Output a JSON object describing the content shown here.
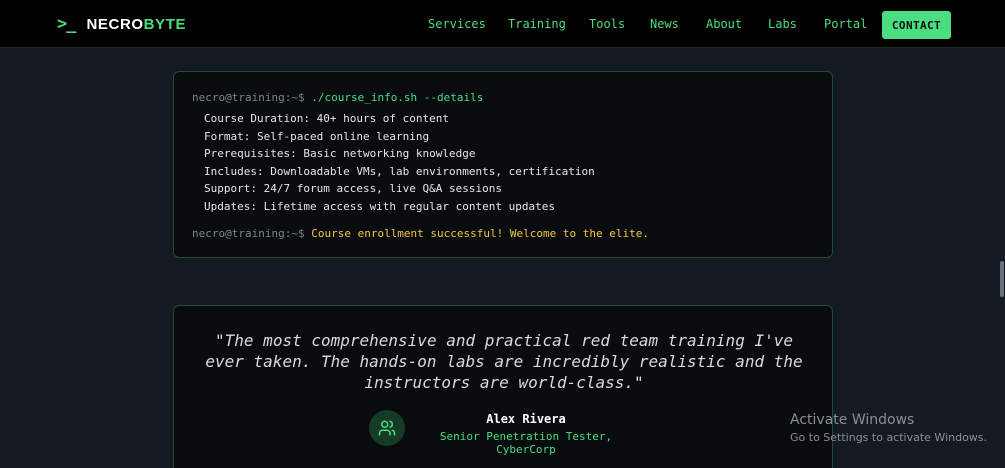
{
  "brand": {
    "icon": ">_",
    "name_primary": "NECRO",
    "name_accent": "BYTE"
  },
  "nav": {
    "links": [
      "Services",
      "Training",
      "Tools",
      "News",
      "About",
      "Labs",
      "Portal"
    ],
    "contact_label": "CONTACT"
  },
  "terminal": {
    "prompt1": "necro@training:~$",
    "command": "./course_info.sh --details",
    "details": [
      "Course Duration: 40+ hours of content",
      "Format: Self-paced online learning",
      "Prerequisites: Basic networking knowledge",
      "Includes: Downloadable VMs, lab environments, certification",
      "Support: 24/7 forum access, live Q&A sessions",
      "Updates: Lifetime access with regular content updates"
    ],
    "prompt2": "necro@training:~$",
    "success_msg": "Course enrollment successful! Welcome to the elite."
  },
  "testimonial": {
    "quote": "\"The most comprehensive and practical red team training I've ever taken. The hands-on labs are incredibly realistic and the instructors are world-class.\"",
    "author_name": "Alex Rivera",
    "author_role": "Senior Penetration Tester, CyberCorp",
    "avatar_icon": "users-icon"
  },
  "watermark": {
    "title": "Activate Windows",
    "subtitle": "Go to Settings to activate Windows."
  },
  "colors": {
    "accent": "#4ade80",
    "background": "#141922",
    "panel": "#090c0e",
    "success": "#f5c542"
  }
}
